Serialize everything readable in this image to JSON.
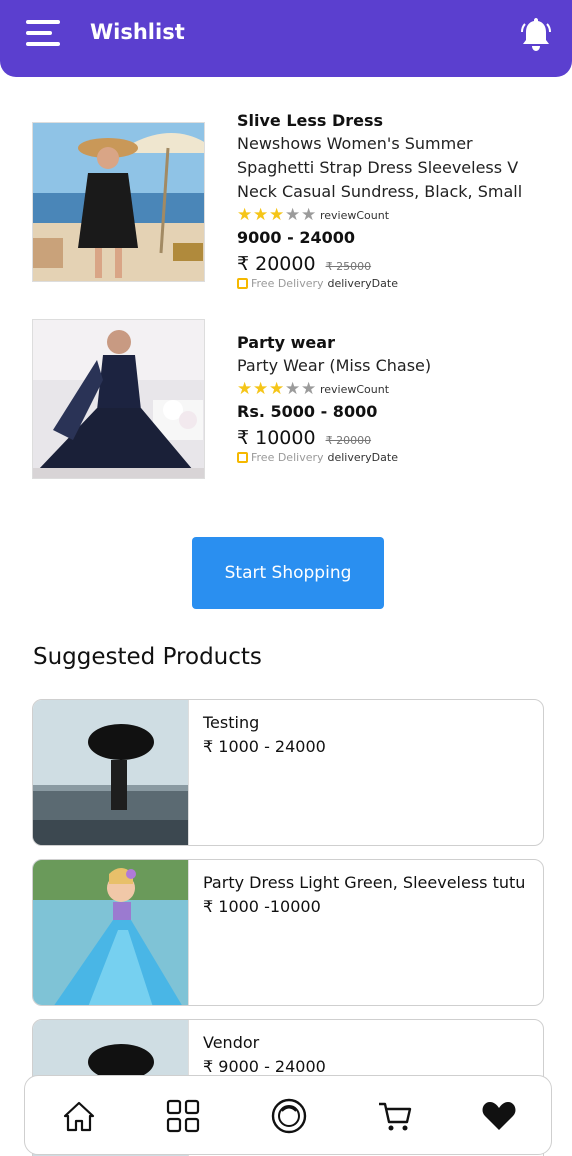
{
  "header": {
    "title": "Wishlist",
    "menu_icon": "hamburger-menu-icon",
    "bell_icon": "bell-icon"
  },
  "colors": {
    "header_bg": "#5b3fcf",
    "button_bg": "#2a8ff0",
    "star": "#f5c518"
  },
  "wishlist": {
    "items": [
      {
        "name": "Slive Less Dress",
        "description": "Newshows Women's Summer Spaghetti Strap Dress Sleeveless V Neck Casual Sundress, Black, Small",
        "rating": 3,
        "rating_max": 5,
        "review_label": "reviewCount",
        "price_range": "9000 - 24000",
        "price": "₹ 20000",
        "old_price": "₹ 25000",
        "delivery_label": "Free Delivery",
        "delivery_date": "deliveryDate"
      },
      {
        "name": "Party wear",
        "description": "Party Wear (Miss Chase)",
        "rating": 3,
        "rating_max": 5,
        "review_label": "reviewCount",
        "price_range": "Rs. 5000 - 8000",
        "price": "₹ 10000",
        "old_price": "₹ 20000",
        "delivery_label": "Free Delivery",
        "delivery_date": "deliveryDate"
      }
    ]
  },
  "start_shopping": {
    "label": "Start Shopping"
  },
  "suggested": {
    "title": "Suggested Products",
    "items": [
      {
        "name": "Testing",
        "price": "₹ 1000 - 24000"
      },
      {
        "name": "Party Dress  Light Green, Sleeveless tutu",
        "price": "₹ 1000 -10000"
      },
      {
        "name": "Vendor",
        "price": "₹ 9000 - 24000"
      }
    ]
  },
  "bottom_nav": {
    "items": [
      {
        "icon": "home-icon"
      },
      {
        "icon": "categories-grid-icon"
      },
      {
        "icon": "explore-circle-icon"
      },
      {
        "icon": "cart-icon"
      },
      {
        "icon": "heart-icon",
        "active": true
      }
    ]
  }
}
